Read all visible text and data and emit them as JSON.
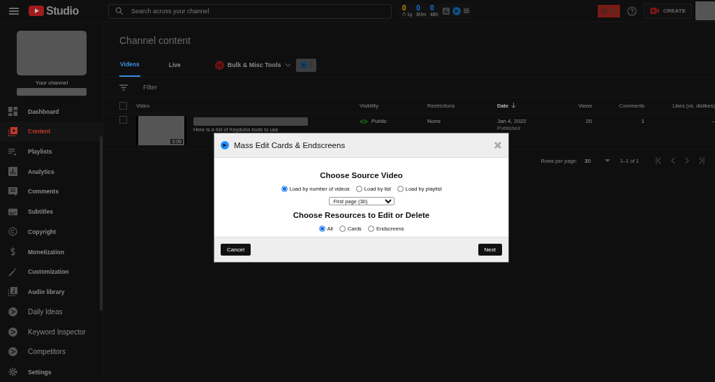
{
  "topbar": {
    "logo": "Studio",
    "search": {
      "placeholder": "Search across your channel"
    },
    "stats": [
      {
        "value": "0",
        "label": "⏱ 1y",
        "color": "#c98a00"
      },
      {
        "value": "0",
        "label": "60m",
        "color": "#1e6fd9"
      },
      {
        "value": "0",
        "label": "48h",
        "color": "#1e6fd9"
      }
    ],
    "create_button": "CREATE"
  },
  "sidebar": {
    "channel_label": "Your channel",
    "items": [
      {
        "label": "Dashboard",
        "kind": "studio",
        "selected": false
      },
      {
        "label": "Content",
        "kind": "studio",
        "selected": true
      },
      {
        "label": "Playlists",
        "kind": "studio",
        "selected": false
      },
      {
        "label": "Analytics",
        "kind": "studio",
        "selected": false
      },
      {
        "label": "Comments",
        "kind": "studio",
        "selected": false
      },
      {
        "label": "Subtitles",
        "kind": "studio",
        "selected": false
      },
      {
        "label": "Copyright",
        "kind": "studio",
        "selected": false
      },
      {
        "label": "Monetization",
        "kind": "studio",
        "selected": false
      },
      {
        "label": "Customization",
        "kind": "studio",
        "selected": false
      },
      {
        "label": "Audio library",
        "kind": "studio",
        "selected": false
      },
      {
        "label": "Daily Ideas",
        "kind": "extension",
        "selected": false
      },
      {
        "label": "Keyword Inspector",
        "kind": "extension",
        "selected": false
      },
      {
        "label": "Competitors",
        "kind": "extension",
        "selected": false
      },
      {
        "label": "Settings",
        "kind": "studio",
        "selected": false
      }
    ]
  },
  "page": {
    "title": "Channel content",
    "tabs": [
      {
        "label": "Videos",
        "selected": true
      },
      {
        "label": "Live",
        "selected": false
      }
    ],
    "tools_menu": "Bulk & Misc Tools",
    "filter": {
      "placeholder": "Filter"
    },
    "table": {
      "all_checked": false,
      "columns": [
        {
          "label": "Video",
          "sorted": false
        },
        {
          "label": "Visibility",
          "sorted": false
        },
        {
          "label": "Restrictions",
          "sorted": false
        },
        {
          "label": "Date",
          "sorted": true
        },
        {
          "label": "Views",
          "sorted": false
        },
        {
          "label": "Comments",
          "sorted": false
        },
        {
          "label": "Likes (vs. dislikes)",
          "sorted": false
        }
      ],
      "rows": [
        {
          "checked": false,
          "duration": "0:09",
          "description": "Here is a list of Keyduba tools to use",
          "visibility": "Public",
          "restrictions": "None",
          "date": "Jan 4, 2022",
          "date_status": "Published",
          "views": "20",
          "comments": "1",
          "likes": "–"
        }
      ]
    },
    "pagination": {
      "label": "Rows per page:",
      "rows_value": "30",
      "range": "1–1 of 1"
    }
  },
  "dialog": {
    "title": "Mass Edit Cards & Endscreens",
    "source_heading": "Choose Source Video",
    "source_options": [
      {
        "label": "Load by number of videos",
        "selected": true
      },
      {
        "label": "Load by list",
        "selected": false
      },
      {
        "label": "Load by playlist",
        "selected": false
      }
    ],
    "page_select": "First page (30)",
    "resource_heading": "Choose Resources to Edit or Delete",
    "resource_options": [
      {
        "label": "All",
        "selected": true
      },
      {
        "label": "Cards",
        "selected": false
      },
      {
        "label": "Endscreens",
        "selected": false
      }
    ],
    "cancel": "Cancel",
    "next": "Next"
  }
}
